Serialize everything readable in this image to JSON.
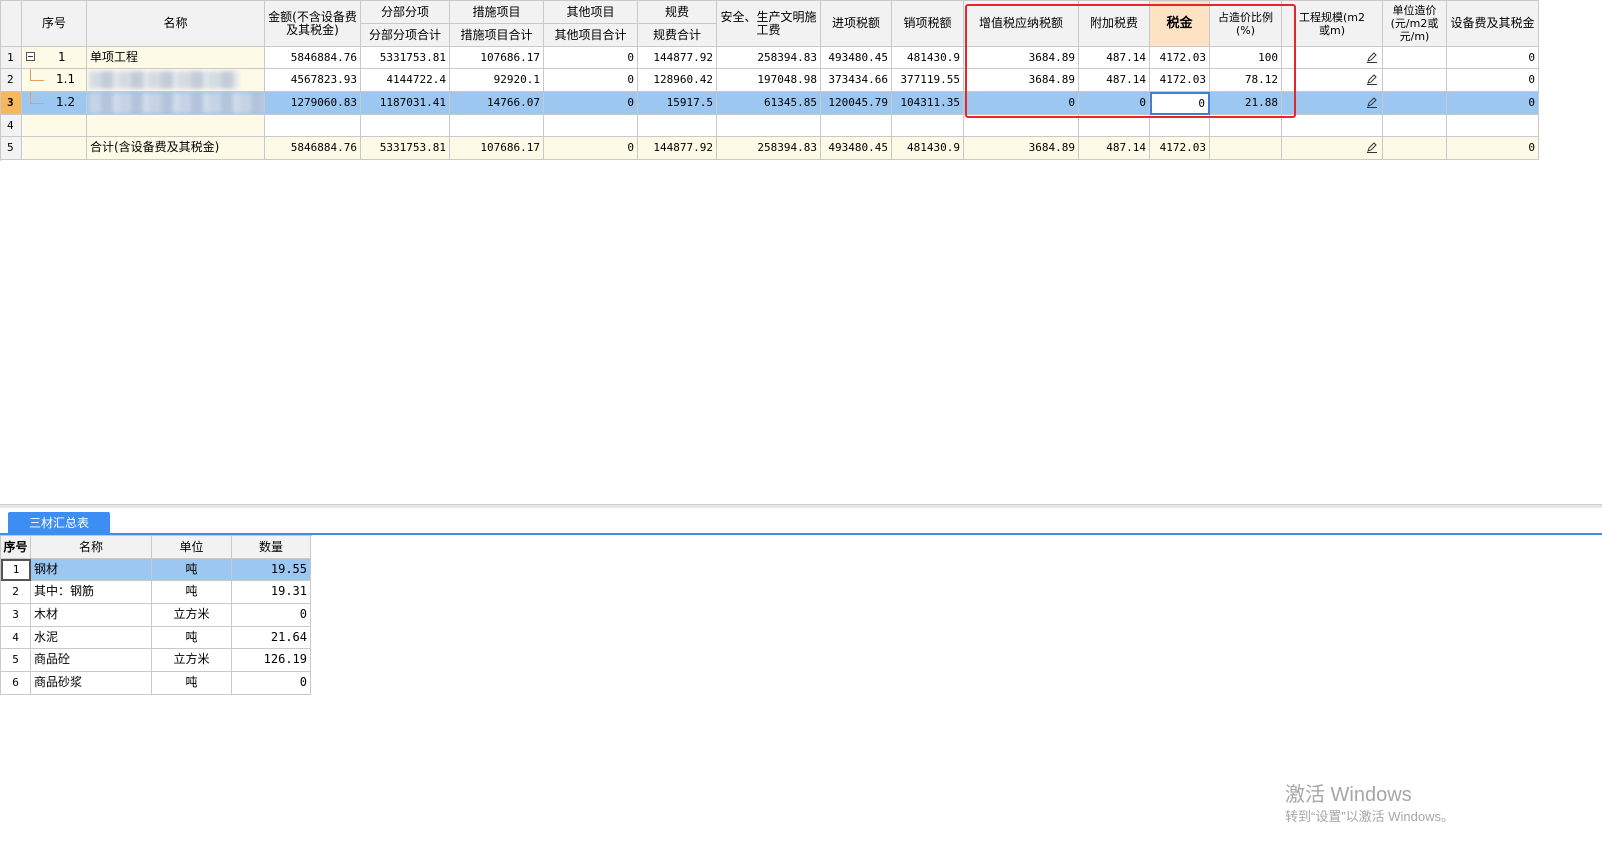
{
  "main_table": {
    "headers": {
      "seq": "序号",
      "name": "名称",
      "amount": "金额(不含设备费及其税金)",
      "fbfx_top": "分部分项",
      "fbfx_sub": "分部分项合计",
      "csxm_top": "措施项目",
      "csxm_sub": "措施项目合计",
      "qtxm_top": "其他项目",
      "qtxm_sub": "其他项目合计",
      "gf_top": "规费",
      "gf_sub": "规费合计",
      "aqsc": "安全、生产文明施工费",
      "jxse": "进项税额",
      "xxse": "销项税额",
      "zzs": "增值税应纳税额",
      "fjsf": "附加税费",
      "sj": "税金",
      "zzjbl": "占造价比例(%)",
      "gcgm": "工程规模(m2或m)",
      "dwzj": "单位造价(元/m2或元/m)",
      "sbf": "设备费及其税金"
    },
    "rows": [
      {
        "row_no": "1",
        "seq": "1",
        "name": "单项工程",
        "amount": "5846884.76",
        "fbfx": "5331753.81",
        "csxm": "107686.17",
        "qtxm": "0",
        "gf": "144877.92",
        "aqsc": "258394.83",
        "jxse": "493480.45",
        "xxse": "481430.9",
        "zzs": "3684.89",
        "fjsf": "487.14",
        "sj": "4172.03",
        "zzjbl": "100",
        "sbf": "0"
      },
      {
        "row_no": "2",
        "seq": "1.1",
        "name": "",
        "amount": "4567823.93",
        "fbfx": "4144722.4",
        "csxm": "92920.1",
        "qtxm": "0",
        "gf": "128960.42",
        "aqsc": "197048.98",
        "jxse": "373434.66",
        "xxse": "377119.55",
        "zzs": "3684.89",
        "fjsf": "487.14",
        "sj": "4172.03",
        "zzjbl": "78.12",
        "sbf": "0"
      },
      {
        "row_no": "3",
        "seq": "1.2",
        "name": "",
        "amount": "1279060.83",
        "fbfx": "1187031.41",
        "csxm": "14766.07",
        "qtxm": "0",
        "gf": "15917.5",
        "aqsc": "61345.85",
        "jxse": "120045.79",
        "xxse": "104311.35",
        "zzs": "0",
        "fjsf": "0",
        "sj": "0",
        "zzjbl": "21.88",
        "sbf": "0"
      },
      {
        "row_no": "4",
        "seq": "",
        "name": "",
        "amount": "",
        "fbfx": "",
        "csxm": "",
        "qtxm": "",
        "gf": "",
        "aqsc": "",
        "jxse": "",
        "xxse": "",
        "zzs": "",
        "fjsf": "",
        "sj": "",
        "zzjbl": "",
        "sbf": ""
      },
      {
        "row_no": "5",
        "seq": "",
        "name": "合计(含设备费及其税金)",
        "amount": "5846884.76",
        "fbfx": "5331753.81",
        "csxm": "107686.17",
        "qtxm": "0",
        "gf": "144877.92",
        "aqsc": "258394.83",
        "jxse": "493480.45",
        "xxse": "481430.9",
        "zzs": "3684.89",
        "fjsf": "487.14",
        "sj": "4172.03",
        "zzjbl": "",
        "sbf": "0"
      }
    ]
  },
  "bottom_panel": {
    "tab_label": "三材汇总表",
    "headers": {
      "seq": "序号",
      "name": "名称",
      "unit": "单位",
      "qty": "数量"
    },
    "rows": [
      {
        "seq": "1",
        "name": "钢材",
        "unit": "吨",
        "qty": "19.55"
      },
      {
        "seq": "2",
        "name": "其中：钢筋",
        "unit": "吨",
        "qty": "19.31"
      },
      {
        "seq": "3",
        "name": "木材",
        "unit": "立方米",
        "qty": "0"
      },
      {
        "seq": "4",
        "name": "水泥",
        "unit": "吨",
        "qty": "21.64"
      },
      {
        "seq": "5",
        "name": "商品砼",
        "unit": "立方米",
        "qty": "126.19"
      },
      {
        "seq": "6",
        "name": "商品砂浆",
        "unit": "吨",
        "qty": "0"
      }
    ]
  },
  "watermark": {
    "line1": "激活 Windows",
    "line2": "转到“设置”以激活 Windows。"
  },
  "colors": {
    "selection": "#9cc7f1",
    "highlight_border": "#e5262a",
    "tab": "#3d8ef2",
    "tax_header": "#fde3c3"
  },
  "icons": {
    "expand": "minus-box-icon",
    "edit": "pencil-icon"
  }
}
